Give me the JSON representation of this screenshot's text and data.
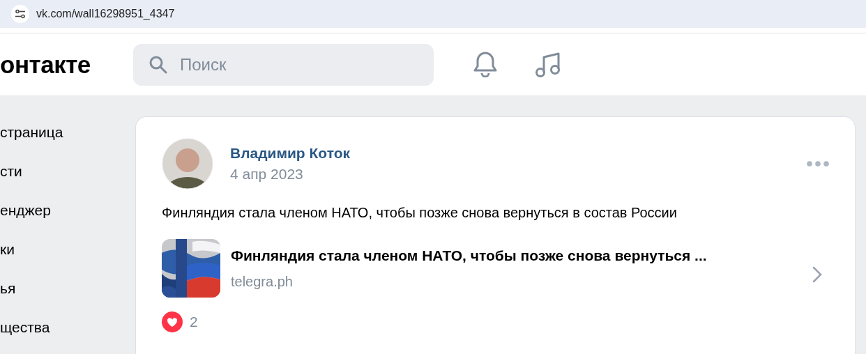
{
  "browser": {
    "url": "vk.com/wall16298951_4347"
  },
  "header": {
    "logo": "онтакте",
    "search": {
      "placeholder": "Поиск"
    }
  },
  "sidebar": {
    "items": [
      {
        "label": "страница"
      },
      {
        "label": "сти"
      },
      {
        "label": "енджер"
      },
      {
        "label": "ки"
      },
      {
        "label": "ья"
      },
      {
        "label": "щества"
      }
    ]
  },
  "post": {
    "author": "Владимир Коток",
    "date": "4 апр 2023",
    "text": "Финляндия стала членом НАТО, чтобы позже снова вернуться в состав России",
    "link": {
      "title": "Финляндия стала членом НАТО, чтобы позже снова вернуться ...",
      "domain": "telegra.ph"
    },
    "likes": {
      "count": "2",
      "liked": true
    }
  }
}
